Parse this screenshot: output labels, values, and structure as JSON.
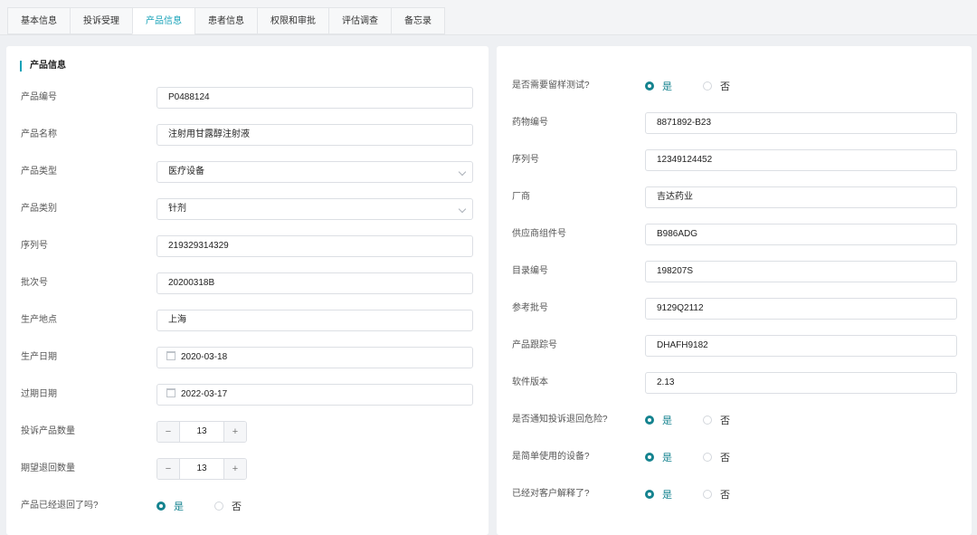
{
  "tabs": [
    "基本信息",
    "投诉受理",
    "产品信息",
    "患者信息",
    "权限和审批",
    "评估调查",
    "备忘录"
  ],
  "active_tab": 2,
  "left": {
    "title": "产品信息",
    "fields": [
      {
        "label": "产品编号",
        "type": "text",
        "value": "P0488124"
      },
      {
        "label": "产品名称",
        "type": "text",
        "value": "注射用甘露醇注射液"
      },
      {
        "label": "产品类型",
        "type": "select",
        "value": "医疗设备"
      },
      {
        "label": "产品类别",
        "type": "select",
        "value": "针剂"
      },
      {
        "label": "序列号",
        "type": "text",
        "value": "219329314329"
      },
      {
        "label": "批次号",
        "type": "text",
        "value": "20200318B"
      },
      {
        "label": "生产地点",
        "type": "text",
        "value": "上海"
      },
      {
        "label": "生产日期",
        "type": "date",
        "value": "2020-03-18"
      },
      {
        "label": "过期日期",
        "type": "date",
        "value": "2022-03-17"
      },
      {
        "label": "投诉产品数量",
        "type": "stepper",
        "value": "13"
      },
      {
        "label": "期望退回数量",
        "type": "stepper",
        "value": "13"
      },
      {
        "label": "产品已经退回了吗?",
        "type": "radio",
        "selected": "是"
      }
    ]
  },
  "right": {
    "fields": [
      {
        "label": "是否需要留样测试?",
        "type": "radio",
        "selected": "是"
      },
      {
        "label": "药物编号",
        "type": "text",
        "value": "8871892-B23"
      },
      {
        "label": "序列号",
        "type": "text",
        "value": "12349124452"
      },
      {
        "label": "厂商",
        "type": "text",
        "value": "吉达药业"
      },
      {
        "label": "供应商组件号",
        "type": "text",
        "value": "B986ADG"
      },
      {
        "label": "目录编号",
        "type": "text",
        "value": "198207S"
      },
      {
        "label": "参考批号",
        "type": "text",
        "value": "9129Q2112"
      },
      {
        "label": "产品跟踪号",
        "type": "text",
        "value": "DHAFH9182"
      },
      {
        "label": "软件版本",
        "type": "text",
        "value": "2.13"
      },
      {
        "label": "是否通知投诉退回危险?",
        "type": "radio",
        "selected": "是"
      },
      {
        "label": "是简单使用的设备?",
        "type": "radio",
        "selected": "是"
      },
      {
        "label": "已经对客户解释了?",
        "type": "radio",
        "selected": "是"
      }
    ]
  },
  "radio_options": [
    "是",
    "否"
  ],
  "stepper": {
    "minus": "−",
    "plus": "+"
  },
  "colors": {
    "accent": "#17a2b8",
    "radio": "#15838f"
  }
}
